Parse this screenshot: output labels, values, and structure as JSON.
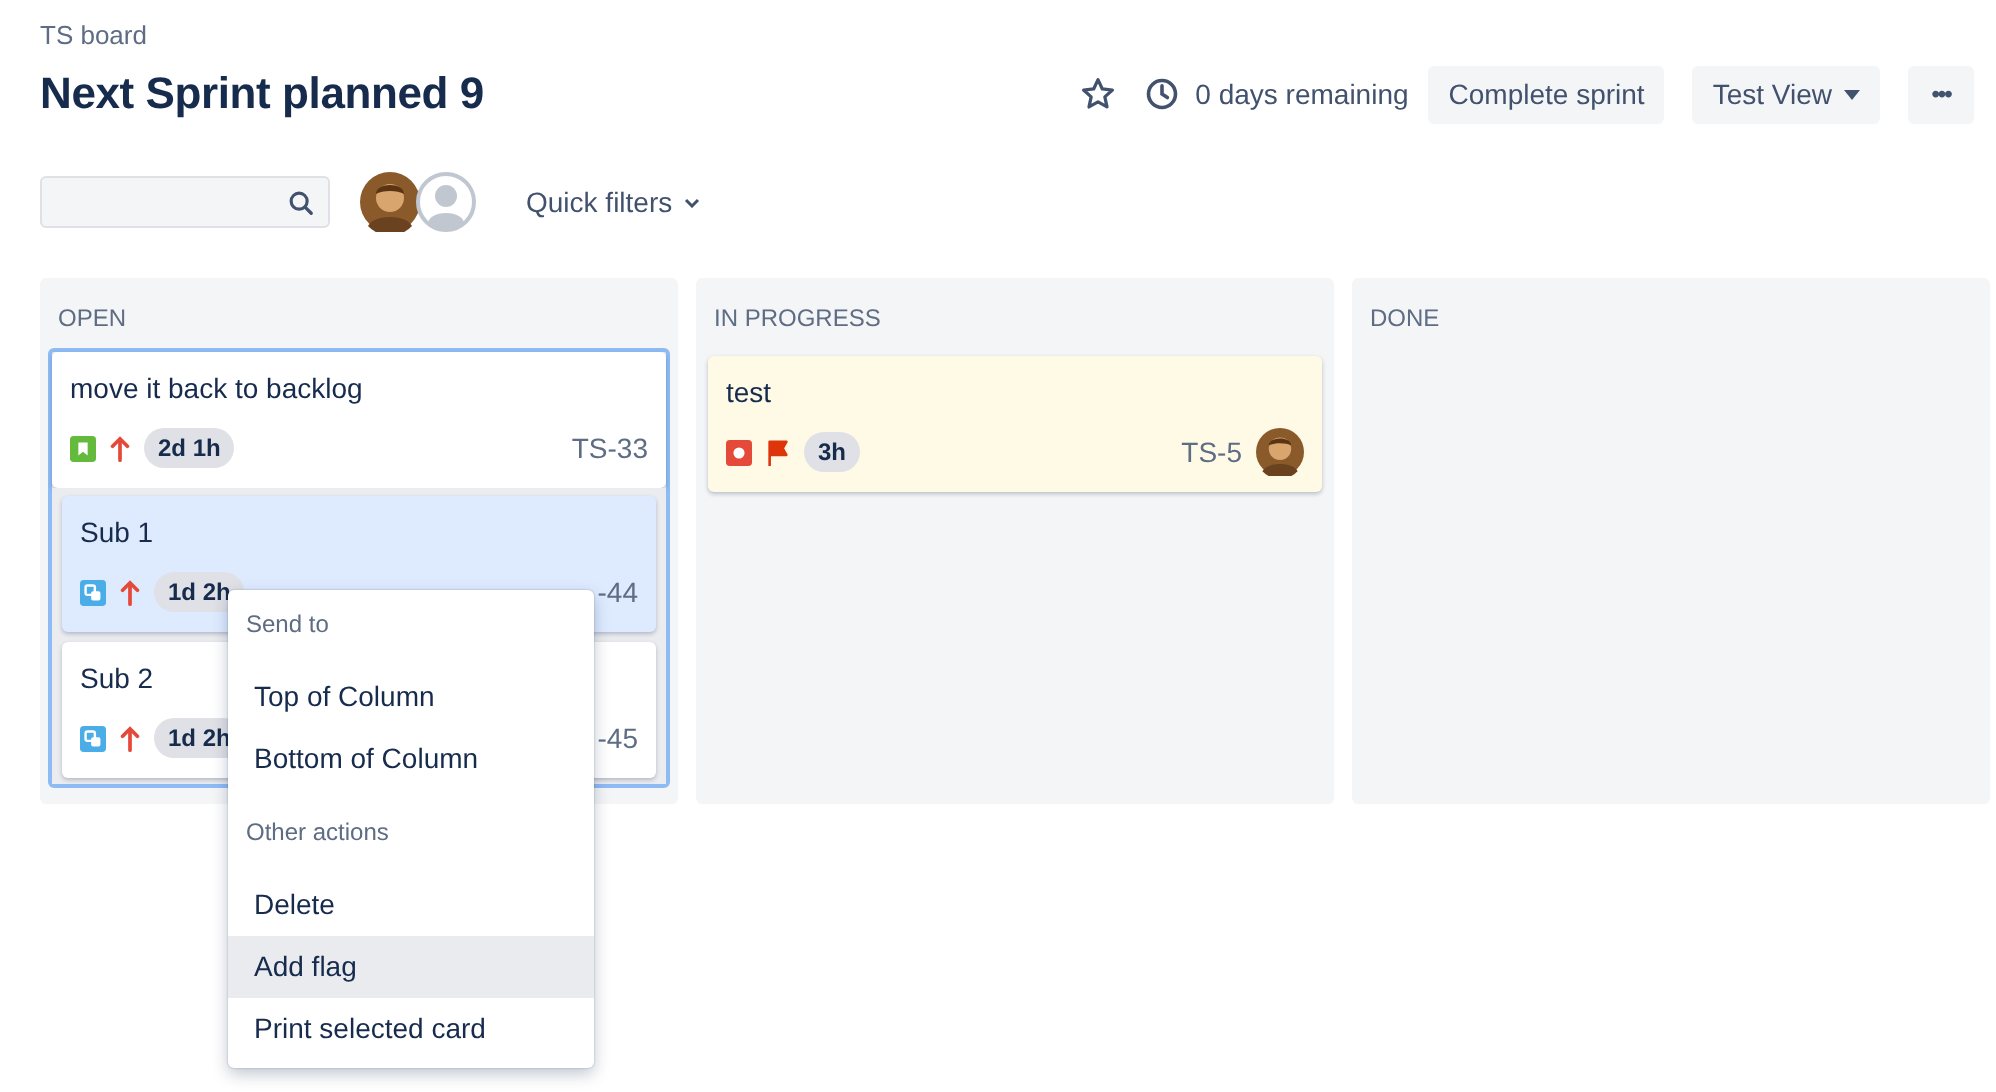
{
  "breadcrumb": "TS board",
  "title": "Next Sprint planned 9",
  "header": {
    "starred": false,
    "remaining": "0 days remaining",
    "buttons": [
      {
        "label": "Complete sprint",
        "kind": "plain"
      },
      {
        "label": "Test View",
        "kind": "dropdown"
      },
      {
        "label": "•••",
        "kind": "more"
      }
    ]
  },
  "avatars": [
    {
      "kind": "photo"
    },
    {
      "kind": "default"
    }
  ],
  "quick_filters": "Quick filters",
  "columns": [
    {
      "title": "OPEN",
      "cards": [
        {
          "summary": "move it back to backlog",
          "kind": "story",
          "high_priority": true,
          "estimate": "2d 1h",
          "key": "TS-33",
          "flagged": false,
          "selected": true,
          "subtasks": [
            {
              "summary": "Sub 1",
              "kind": "subtask",
              "high_priority": true,
              "estimate": "1d 2h",
              "key": "-44",
              "selected": true
            },
            {
              "summary": "Sub 2",
              "kind": "subtask",
              "high_priority": true,
              "estimate": "1d 2h",
              "key": "-45",
              "selected": false
            }
          ]
        }
      ]
    },
    {
      "title": "IN PROGRESS",
      "cards": [
        {
          "summary": "test",
          "kind": "bug",
          "high_priority": false,
          "estimate": "3h",
          "key": "TS-5",
          "flagged": true,
          "selected": false,
          "has_assignee": true
        }
      ]
    },
    {
      "title": "DONE"
    }
  ],
  "context_menu": {
    "sections": [
      {
        "heading": "Send to",
        "items": [
          {
            "label": "Top of Column",
            "hovered": false
          },
          {
            "label": "Bottom of Column",
            "hovered": false
          }
        ]
      },
      {
        "heading": "Other actions",
        "items": [
          {
            "label": "Delete",
            "hovered": false
          },
          {
            "label": "Add flag",
            "hovered": true
          },
          {
            "label": "Print selected card",
            "hovered": false
          }
        ]
      }
    ]
  }
}
